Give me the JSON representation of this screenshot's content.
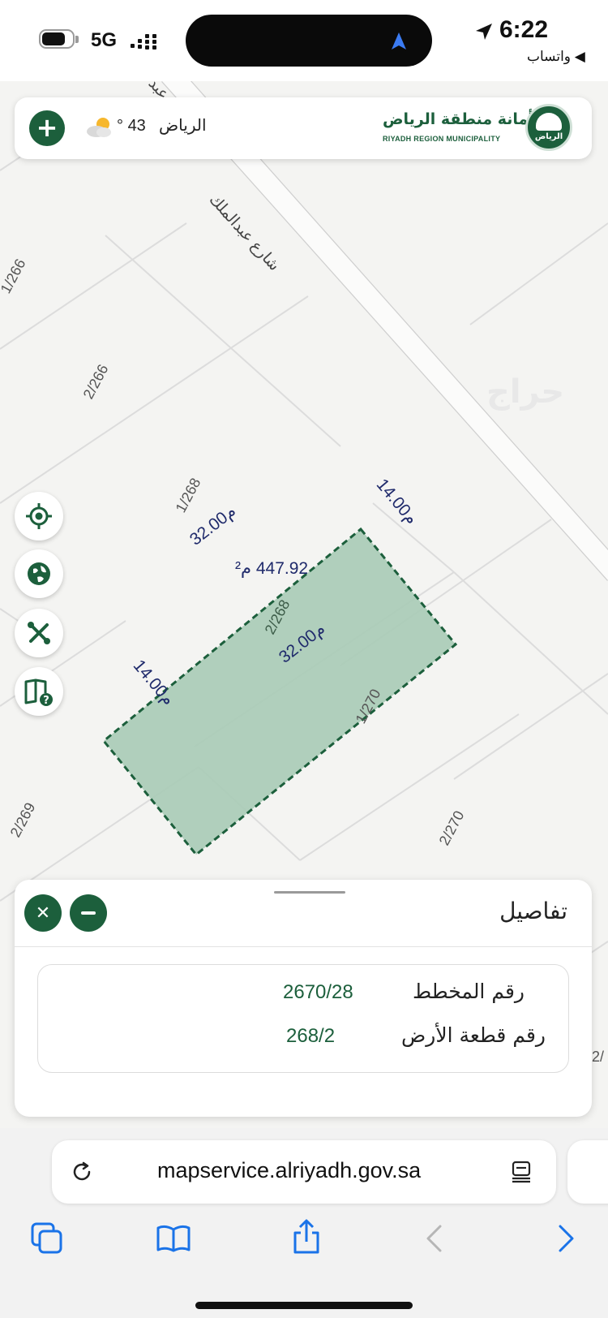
{
  "status_bar": {
    "time": "6:22",
    "network": "5G",
    "back_app": "◀ واتساب"
  },
  "header": {
    "logo_title_ar": "أمانة منطقة الرياض",
    "logo_title_en": "RIYADH REGION MUNICIPALITY",
    "logo_badge_text": "الرياض",
    "weather_city": "الرياض",
    "weather_temp": "43 °",
    "add_icon": "plus-icon",
    "weather_icon": "partly-cloudy-icon"
  },
  "map": {
    "street_name": "شارع عبدالملك",
    "street_top_fragment": "عبد",
    "parcel_labels": [
      "1/266",
      "2/266",
      "1/268",
      "2/268",
      "1/270",
      "2/269",
      "2/270"
    ],
    "dimensions": {
      "top_side": "32.00م",
      "bottom_side": "32.00م",
      "right_side": "14.00م",
      "left_side": "14.00م"
    },
    "area": "447.92 م²",
    "watermark": "حراج",
    "parcel_fill": "#a9cbb6",
    "parcel_border": "#1c5f3c"
  },
  "tools": [
    {
      "name": "locate-icon"
    },
    {
      "name": "basemap-globe-icon"
    },
    {
      "name": "tools-icon"
    },
    {
      "name": "help-book-icon"
    }
  ],
  "details": {
    "title": "تفاصيل",
    "rows": [
      {
        "label": "رقم المخطط",
        "value": "2670/28"
      },
      {
        "label": "رقم قطعة الأرض",
        "value": "268/2"
      }
    ],
    "edge_fragment": "2/"
  },
  "browser": {
    "url": "mapservice.alriyadh.gov.sa",
    "reload_icon": "reload-icon",
    "reader_icon": "reader-icon",
    "toolbar": [
      "tabs-icon",
      "bookmarks-icon",
      "share-icon",
      "back-icon",
      "forward-icon"
    ]
  },
  "colors": {
    "brand_green": "#1c5f3c",
    "dimension_text": "#1f2a6b"
  }
}
